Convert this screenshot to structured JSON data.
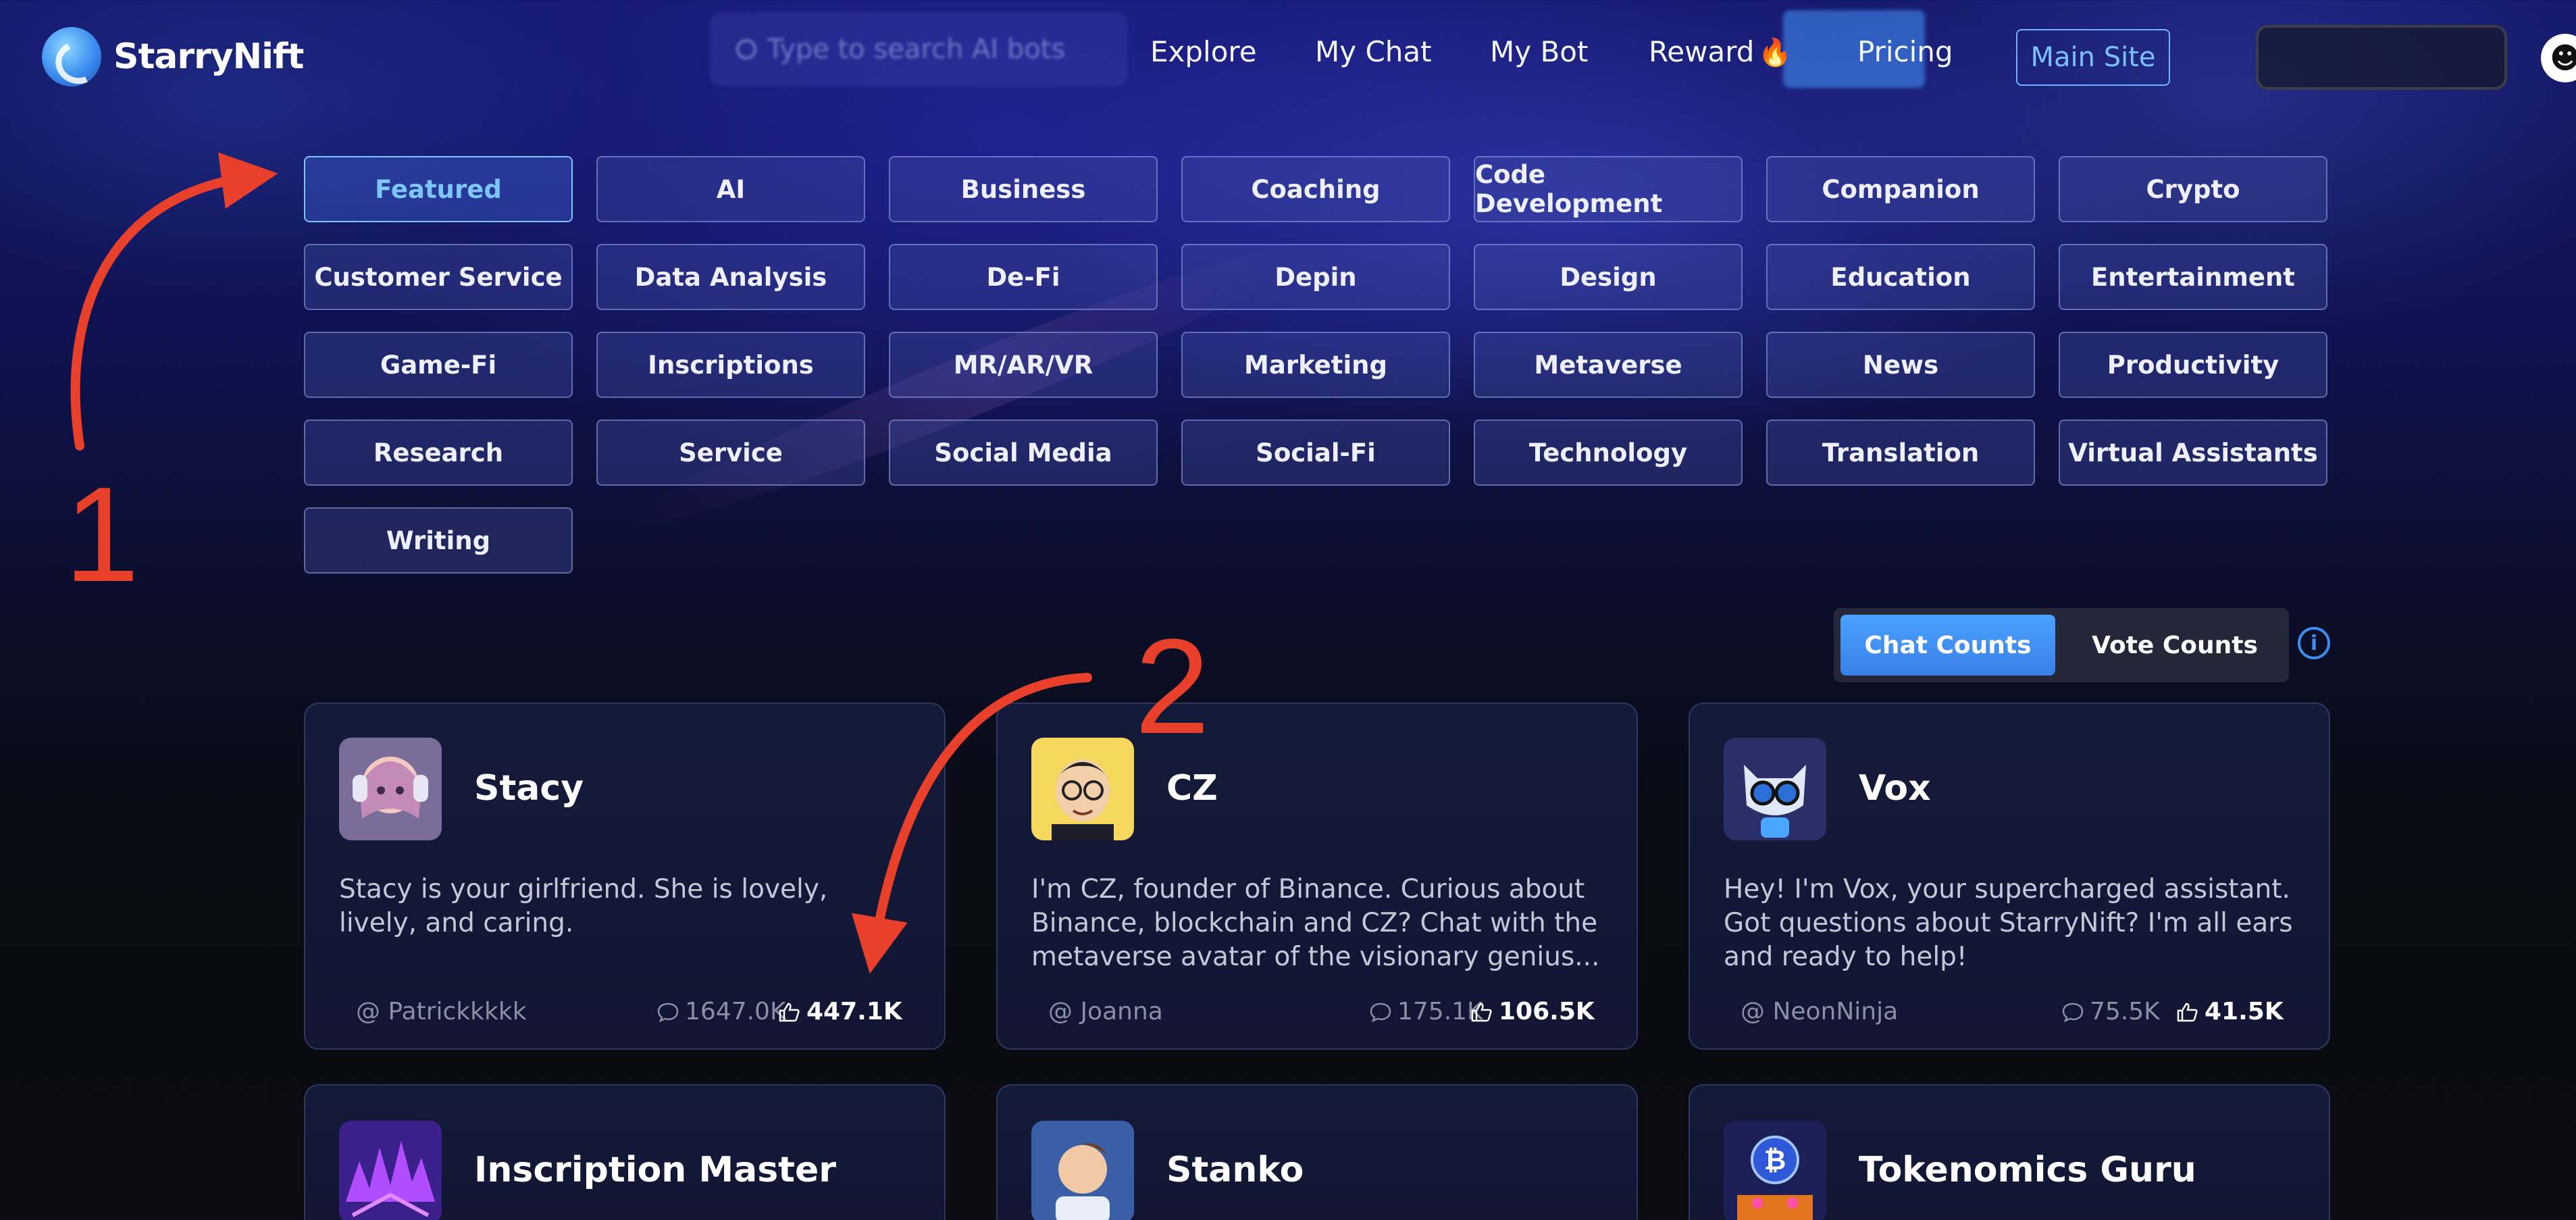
{
  "brand": {
    "name": "StarryNift"
  },
  "search": {
    "placeholder": "Type to search AI bots"
  },
  "nav": [
    {
      "label": "Explore"
    },
    {
      "label": "My Chat"
    },
    {
      "label": "My Bot"
    },
    {
      "label": "Reward"
    },
    {
      "label": "Pricing"
    }
  ],
  "main_site_label": "Main Site",
  "categories": [
    "Featured",
    "AI",
    "Business",
    "Coaching",
    "Code Development",
    "Companion",
    "Crypto",
    "Customer Service",
    "Data Analysis",
    "De-Fi",
    "Depin",
    "Design",
    "Education",
    "Entertainment",
    "Game-Fi",
    "Inscriptions",
    "MR/AR/VR",
    "Marketing",
    "Metaverse",
    "News",
    "Productivity",
    "Research",
    "Service",
    "Social Media",
    "Social-Fi",
    "Technology",
    "Translation",
    "Virtual Assistants",
    "Writing"
  ],
  "selected_category": "Featured",
  "sort_toggle": {
    "chat_counts": "Chat Counts",
    "vote_counts": "Vote Counts",
    "selected": "Chat Counts"
  },
  "cards": [
    {
      "name": "Stacy",
      "description": "Stacy is your girlfriend. She is lovely, lively, and caring.",
      "author": "@ Patrickkkkk",
      "chats": "1647.0K",
      "votes": "447.1K"
    },
    {
      "name": "CZ",
      "description": "I'm CZ, founder of Binance. Curious about Binance, blockchain and CZ? Chat with the metaverse avatar of the visionary genius...",
      "author": "@ Joanna",
      "chats": "175.1K",
      "votes": "106.5K"
    },
    {
      "name": "Vox",
      "description": "Hey! I'm Vox, your supercharged assistant. Got questions about StarryNift? I'm all ears and ready to help!",
      "author": "@ NeonNinja",
      "chats": "75.5K",
      "votes": "41.5K"
    },
    {
      "name": "Inscription Master"
    },
    {
      "name": "Stanko"
    },
    {
      "name": "Tokenomics Guru"
    }
  ],
  "annotations": {
    "one": "1",
    "two": "2",
    "color": "#e8402a"
  },
  "colors": {
    "accent": "#3b8df0",
    "active_tag": "#7ec6ff"
  }
}
